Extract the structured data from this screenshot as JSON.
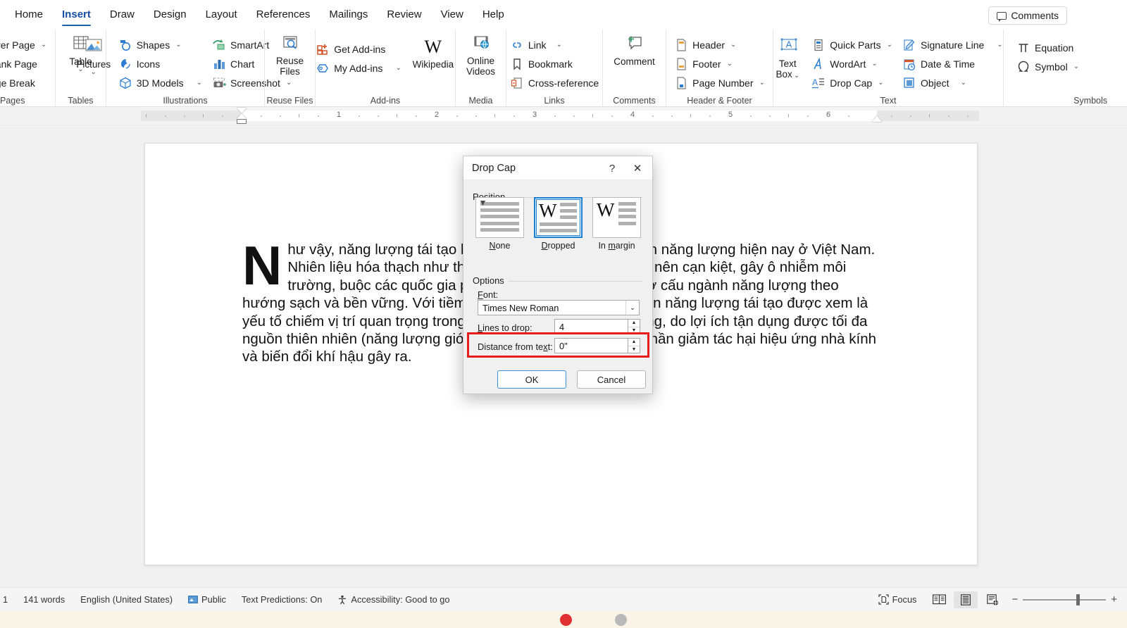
{
  "tabs": [
    {
      "label": "Home",
      "active": false
    },
    {
      "label": "Insert",
      "active": true
    },
    {
      "label": "Draw",
      "active": false
    },
    {
      "label": "Design",
      "active": false
    },
    {
      "label": "Layout",
      "active": false
    },
    {
      "label": "References",
      "active": false
    },
    {
      "label": "Mailings",
      "active": false
    },
    {
      "label": "Review",
      "active": false
    },
    {
      "label": "View",
      "active": false
    },
    {
      "label": "Help",
      "active": false
    }
  ],
  "comments_button": "Comments",
  "ribbon": {
    "pages": {
      "label": "Pages",
      "items": [
        "ver Page",
        "ank Page",
        "ge Break"
      ]
    },
    "tables": {
      "label": "Tables",
      "table": "Table"
    },
    "illustrations": {
      "label": "Illustrations",
      "pictures": "Pictures",
      "shapes": "Shapes",
      "icons": "Icons",
      "models3d": "3D Models",
      "smartart": "SmartArt",
      "chart": "Chart",
      "screenshot": "Screenshot"
    },
    "reuse": {
      "label": "Reuse Files",
      "line1": "Reuse",
      "line2": "Files"
    },
    "addins": {
      "label": "Add-ins",
      "get": "Get Add-ins",
      "my": "My Add-ins",
      "wikipedia": "Wikipedia",
      "w_glyph": "W"
    },
    "media": {
      "label": "Media",
      "line1": "Online",
      "line2": "Videos"
    },
    "links": {
      "label": "Links",
      "link": "Link",
      "bookmark": "Bookmark",
      "crossref": "Cross-reference"
    },
    "comments_group": {
      "label": "Comments",
      "comment": "Comment"
    },
    "headerfooter": {
      "label": "Header & Footer",
      "header": "Header",
      "footer": "Footer",
      "pagenumber": "Page Number"
    },
    "text": {
      "label": "Text",
      "textbox_l1": "Text",
      "textbox_l2": "Box",
      "textbox_glyph": "A",
      "quickparts": "Quick Parts",
      "wordart": "WordArt",
      "dropcap": "Drop Cap",
      "signature": "Signature Line",
      "datetime": "Date & Time",
      "object": "Object"
    },
    "symbols": {
      "label": "Symbols",
      "equation": "Equation",
      "symbol": "Symbol"
    }
  },
  "ruler": {
    "numbers": [
      "1",
      "2",
      "3",
      "4",
      "5",
      "6"
    ]
  },
  "document": {
    "dropcap_letter": "N",
    "paragraph": "hư vậy, năng lượng tái tạo là xu hướng tất yếu của ngành năng lượng hiện nay ở Việt Nam. Nhiên liệu hóa thạch như than đá, dầu mỏ ngày càng trở nên cạn kiệt, gây ô nhiễm môi trường, buộc các quốc gia phải đẩy mạnh chuyển dịch cơ cấu ngành năng lượng theo hướng sạch và bền vững. Với tiềm năng sẵn có, phát triển nguồn năng lượng tái tạo được xem là yếu tố chiếm vị trí quan trọng trong sự phát triển kinh tế bền vững, do lợi ích tận dụng được tối đa nguồn thiên nhiên (năng lượng gió, mặt trời…), cũng như góp phần giảm tác hại hiệu ứng nhà kính và biến đổi khí hậu gây ra."
  },
  "dialog": {
    "title": "Drop Cap",
    "help_glyph": "?",
    "close_glyph": "✕",
    "position_legend": "Position",
    "options_legend": "Options",
    "positions": [
      {
        "caption_pre": "",
        "caption_u": "N",
        "caption_post": "one",
        "selected": false,
        "name": "None"
      },
      {
        "caption_pre": "",
        "caption_u": "D",
        "caption_post": "ropped",
        "selected": true,
        "name": "Dropped"
      },
      {
        "caption_pre": "In ",
        "caption_u": "m",
        "caption_post": "argin",
        "selected": false,
        "name": "In margin"
      }
    ],
    "thumb_letter": "W",
    "font_label_pre": "F",
    "font_label_u": "o",
    "font_label_post": "nt:",
    "font_value": "Times New Roman",
    "lines_label_pre": "",
    "lines_label_u": "L",
    "lines_label_post": "ines to drop:",
    "lines_value": "4",
    "distance_label_pre": "Distance from te",
    "distance_label_u": "x",
    "distance_label_post": "t:",
    "distance_value": "0\"",
    "ok": "OK",
    "cancel": "Cancel",
    "highlight_color": "#e81c1c"
  },
  "status": {
    "page_number": "1",
    "words": "141 words",
    "language": "English (United States)",
    "sensitivity": "Public",
    "predictions": "Text Predictions: On",
    "accessibility": "Accessibility: Good to go",
    "focus": "Focus",
    "zoom_minus": "−",
    "zoom_plus": "+"
  }
}
